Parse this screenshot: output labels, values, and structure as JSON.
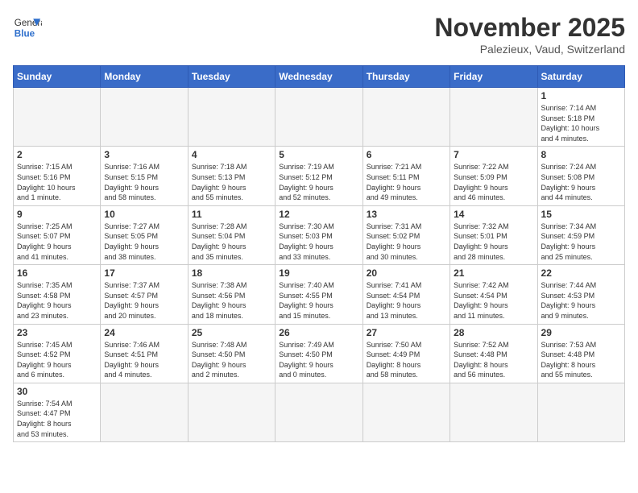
{
  "header": {
    "logo_general": "General",
    "logo_blue": "Blue",
    "month_year": "November 2025",
    "location": "Palezieux, Vaud, Switzerland"
  },
  "weekdays": [
    "Sunday",
    "Monday",
    "Tuesday",
    "Wednesday",
    "Thursday",
    "Friday",
    "Saturday"
  ],
  "weeks": [
    [
      {
        "day": "",
        "info": ""
      },
      {
        "day": "",
        "info": ""
      },
      {
        "day": "",
        "info": ""
      },
      {
        "day": "",
        "info": ""
      },
      {
        "day": "",
        "info": ""
      },
      {
        "day": "",
        "info": ""
      },
      {
        "day": "1",
        "info": "Sunrise: 7:14 AM\nSunset: 5:18 PM\nDaylight: 10 hours\nand 4 minutes."
      }
    ],
    [
      {
        "day": "2",
        "info": "Sunrise: 7:15 AM\nSunset: 5:16 PM\nDaylight: 10 hours\nand 1 minute."
      },
      {
        "day": "3",
        "info": "Sunrise: 7:16 AM\nSunset: 5:15 PM\nDaylight: 9 hours\nand 58 minutes."
      },
      {
        "day": "4",
        "info": "Sunrise: 7:18 AM\nSunset: 5:13 PM\nDaylight: 9 hours\nand 55 minutes."
      },
      {
        "day": "5",
        "info": "Sunrise: 7:19 AM\nSunset: 5:12 PM\nDaylight: 9 hours\nand 52 minutes."
      },
      {
        "day": "6",
        "info": "Sunrise: 7:21 AM\nSunset: 5:11 PM\nDaylight: 9 hours\nand 49 minutes."
      },
      {
        "day": "7",
        "info": "Sunrise: 7:22 AM\nSunset: 5:09 PM\nDaylight: 9 hours\nand 46 minutes."
      },
      {
        "day": "8",
        "info": "Sunrise: 7:24 AM\nSunset: 5:08 PM\nDaylight: 9 hours\nand 44 minutes."
      }
    ],
    [
      {
        "day": "9",
        "info": "Sunrise: 7:25 AM\nSunset: 5:07 PM\nDaylight: 9 hours\nand 41 minutes."
      },
      {
        "day": "10",
        "info": "Sunrise: 7:27 AM\nSunset: 5:05 PM\nDaylight: 9 hours\nand 38 minutes."
      },
      {
        "day": "11",
        "info": "Sunrise: 7:28 AM\nSunset: 5:04 PM\nDaylight: 9 hours\nand 35 minutes."
      },
      {
        "day": "12",
        "info": "Sunrise: 7:30 AM\nSunset: 5:03 PM\nDaylight: 9 hours\nand 33 minutes."
      },
      {
        "day": "13",
        "info": "Sunrise: 7:31 AM\nSunset: 5:02 PM\nDaylight: 9 hours\nand 30 minutes."
      },
      {
        "day": "14",
        "info": "Sunrise: 7:32 AM\nSunset: 5:01 PM\nDaylight: 9 hours\nand 28 minutes."
      },
      {
        "day": "15",
        "info": "Sunrise: 7:34 AM\nSunset: 4:59 PM\nDaylight: 9 hours\nand 25 minutes."
      }
    ],
    [
      {
        "day": "16",
        "info": "Sunrise: 7:35 AM\nSunset: 4:58 PM\nDaylight: 9 hours\nand 23 minutes."
      },
      {
        "day": "17",
        "info": "Sunrise: 7:37 AM\nSunset: 4:57 PM\nDaylight: 9 hours\nand 20 minutes."
      },
      {
        "day": "18",
        "info": "Sunrise: 7:38 AM\nSunset: 4:56 PM\nDaylight: 9 hours\nand 18 minutes."
      },
      {
        "day": "19",
        "info": "Sunrise: 7:40 AM\nSunset: 4:55 PM\nDaylight: 9 hours\nand 15 minutes."
      },
      {
        "day": "20",
        "info": "Sunrise: 7:41 AM\nSunset: 4:54 PM\nDaylight: 9 hours\nand 13 minutes."
      },
      {
        "day": "21",
        "info": "Sunrise: 7:42 AM\nSunset: 4:54 PM\nDaylight: 9 hours\nand 11 minutes."
      },
      {
        "day": "22",
        "info": "Sunrise: 7:44 AM\nSunset: 4:53 PM\nDaylight: 9 hours\nand 9 minutes."
      }
    ],
    [
      {
        "day": "23",
        "info": "Sunrise: 7:45 AM\nSunset: 4:52 PM\nDaylight: 9 hours\nand 6 minutes."
      },
      {
        "day": "24",
        "info": "Sunrise: 7:46 AM\nSunset: 4:51 PM\nDaylight: 9 hours\nand 4 minutes."
      },
      {
        "day": "25",
        "info": "Sunrise: 7:48 AM\nSunset: 4:50 PM\nDaylight: 9 hours\nand 2 minutes."
      },
      {
        "day": "26",
        "info": "Sunrise: 7:49 AM\nSunset: 4:50 PM\nDaylight: 9 hours\nand 0 minutes."
      },
      {
        "day": "27",
        "info": "Sunrise: 7:50 AM\nSunset: 4:49 PM\nDaylight: 8 hours\nand 58 minutes."
      },
      {
        "day": "28",
        "info": "Sunrise: 7:52 AM\nSunset: 4:48 PM\nDaylight: 8 hours\nand 56 minutes."
      },
      {
        "day": "29",
        "info": "Sunrise: 7:53 AM\nSunset: 4:48 PM\nDaylight: 8 hours\nand 55 minutes."
      }
    ],
    [
      {
        "day": "30",
        "info": "Sunrise: 7:54 AM\nSunset: 4:47 PM\nDaylight: 8 hours\nand 53 minutes."
      },
      {
        "day": "",
        "info": ""
      },
      {
        "day": "",
        "info": ""
      },
      {
        "day": "",
        "info": ""
      },
      {
        "day": "",
        "info": ""
      },
      {
        "day": "",
        "info": ""
      },
      {
        "day": "",
        "info": ""
      }
    ]
  ]
}
